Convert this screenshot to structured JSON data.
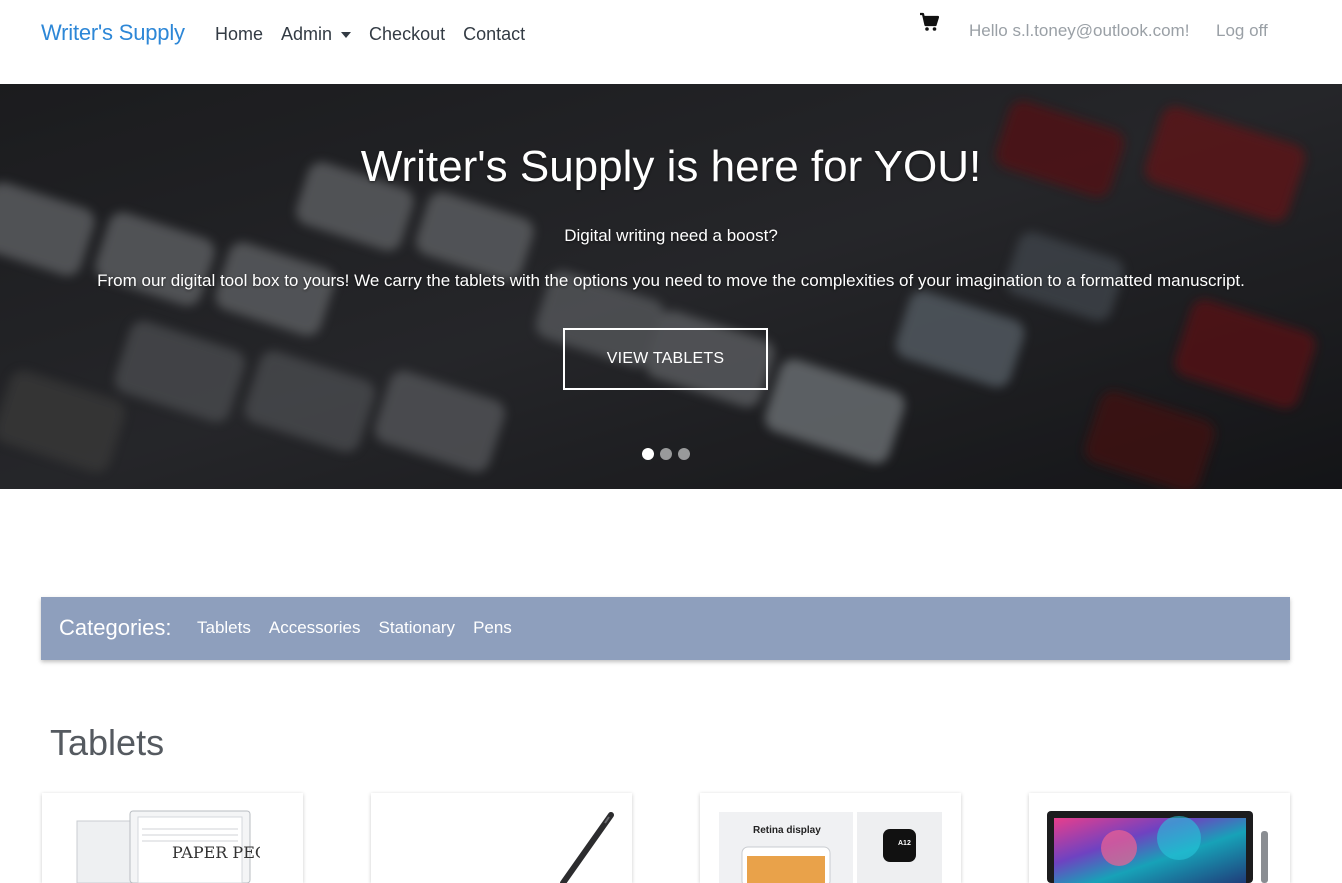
{
  "navbar": {
    "brand": "Writer's Supply",
    "links": [
      "Home",
      "Admin",
      "Checkout",
      "Contact"
    ],
    "user_greeting": "Hello s.l.toney@outlook.com!",
    "logoff": "Log off"
  },
  "hero": {
    "title": "Writer's Supply is here for YOU!",
    "subtitle": "Digital writing need a boost?",
    "description": "From our digital tool box to yours! We carry the tablets with the options you need to move the complexities of your imagination to a formatted manuscript.",
    "button_label": "VIEW TABLETS",
    "slide_count": 3,
    "active_slide": 1
  },
  "categories": {
    "title": "Categories:",
    "items": [
      "Tablets",
      "Accessories",
      "Stationary",
      "Pens"
    ]
  },
  "section": {
    "title": "Tablets"
  },
  "products": [
    {
      "image": "paper-tablet-image",
      "image_text": "PAPER PEOPLE"
    },
    {
      "image": "stylus-pen-image"
    },
    {
      "image": "ipad-retina-image",
      "image_text": "Retina display",
      "chip_text": "A12"
    },
    {
      "image": "surface-tablet-image"
    }
  ],
  "colors": {
    "brand": "#2d87d7",
    "category_bar": "#8e9fbd",
    "nav_text": "#333b44",
    "muted_text": "#9aa0a6"
  },
  "icons": {
    "cart": "shopping-cart-icon",
    "admin_dropdown": "chevron-down-icon"
  }
}
